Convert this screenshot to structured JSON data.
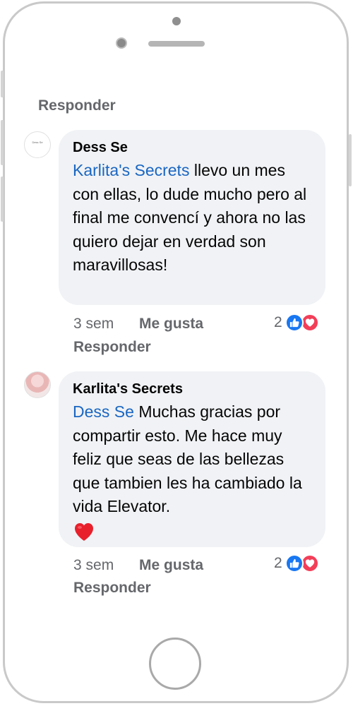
{
  "top": {
    "reply_label": "Responder"
  },
  "comments": [
    {
      "author": "Dess Se",
      "mention": "Karlita's Secrets",
      "text": " llevo un mes con ellas, lo dude mucho pero al final me convencí y ahora no las quiero dejar en verdad son maravillosas!",
      "time": "3 sem",
      "like_label": "Me gusta",
      "reply_label": "Responder",
      "reaction_count": "2",
      "avatar_text": "Dess Se"
    },
    {
      "author": "Karlita's Secrets",
      "mention": "Dess Se",
      "text": " Muchas gracias por compartir esto. Me hace muy feliz que seas de las bellezas que tambien les ha cambiado la vida Elevator.",
      "time": "3 sem",
      "like_label": "Me gusta",
      "reply_label": "Responder",
      "reaction_count": "2"
    }
  ],
  "colors": {
    "mention": "#1a66c2",
    "bubble": "#f0f2f5",
    "like_blue": "#1877f2",
    "love_red": "#f33e58"
  }
}
